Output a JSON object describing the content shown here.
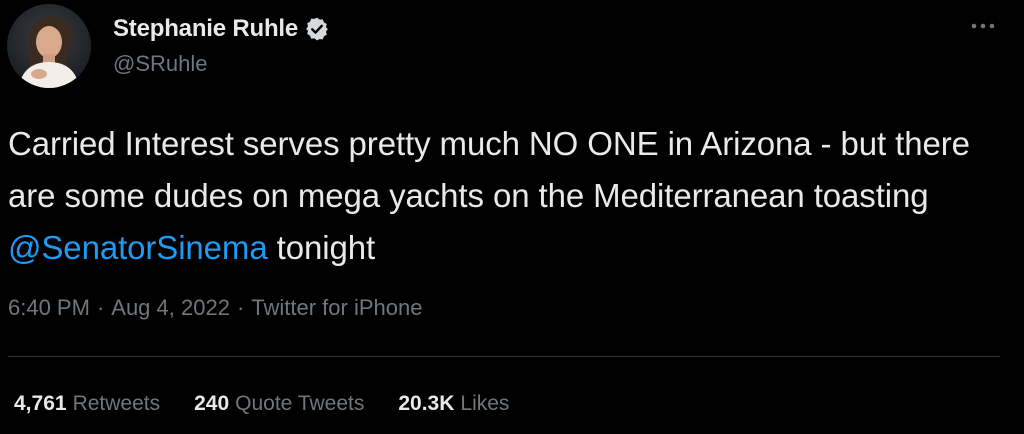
{
  "author": {
    "display_name": "Stephanie Ruhle",
    "handle": "@SRuhle",
    "verified_icon": "verified-badge-icon"
  },
  "tweet": {
    "text_part1": "Carried Interest serves pretty much NO ONE in Arizona - but there are some dudes on mega yachts on the Mediterranean toasting ",
    "mention": "@SenatorSinema",
    "text_part2": " tonight",
    "time": "6:40 PM",
    "date": "Aug 4, 2022",
    "source": "Twitter for iPhone",
    "separator": "·"
  },
  "stats": {
    "retweets_count": "4,761",
    "retweets_label": "Retweets",
    "quotes_count": "240",
    "quotes_label": "Quote Tweets",
    "likes_count": "20.3K",
    "likes_label": "Likes"
  },
  "colors": {
    "background": "#000000",
    "text": "#e7e9ea",
    "secondary": "#71767b",
    "link": "#1d9bf0",
    "divider": "#2f3336"
  }
}
